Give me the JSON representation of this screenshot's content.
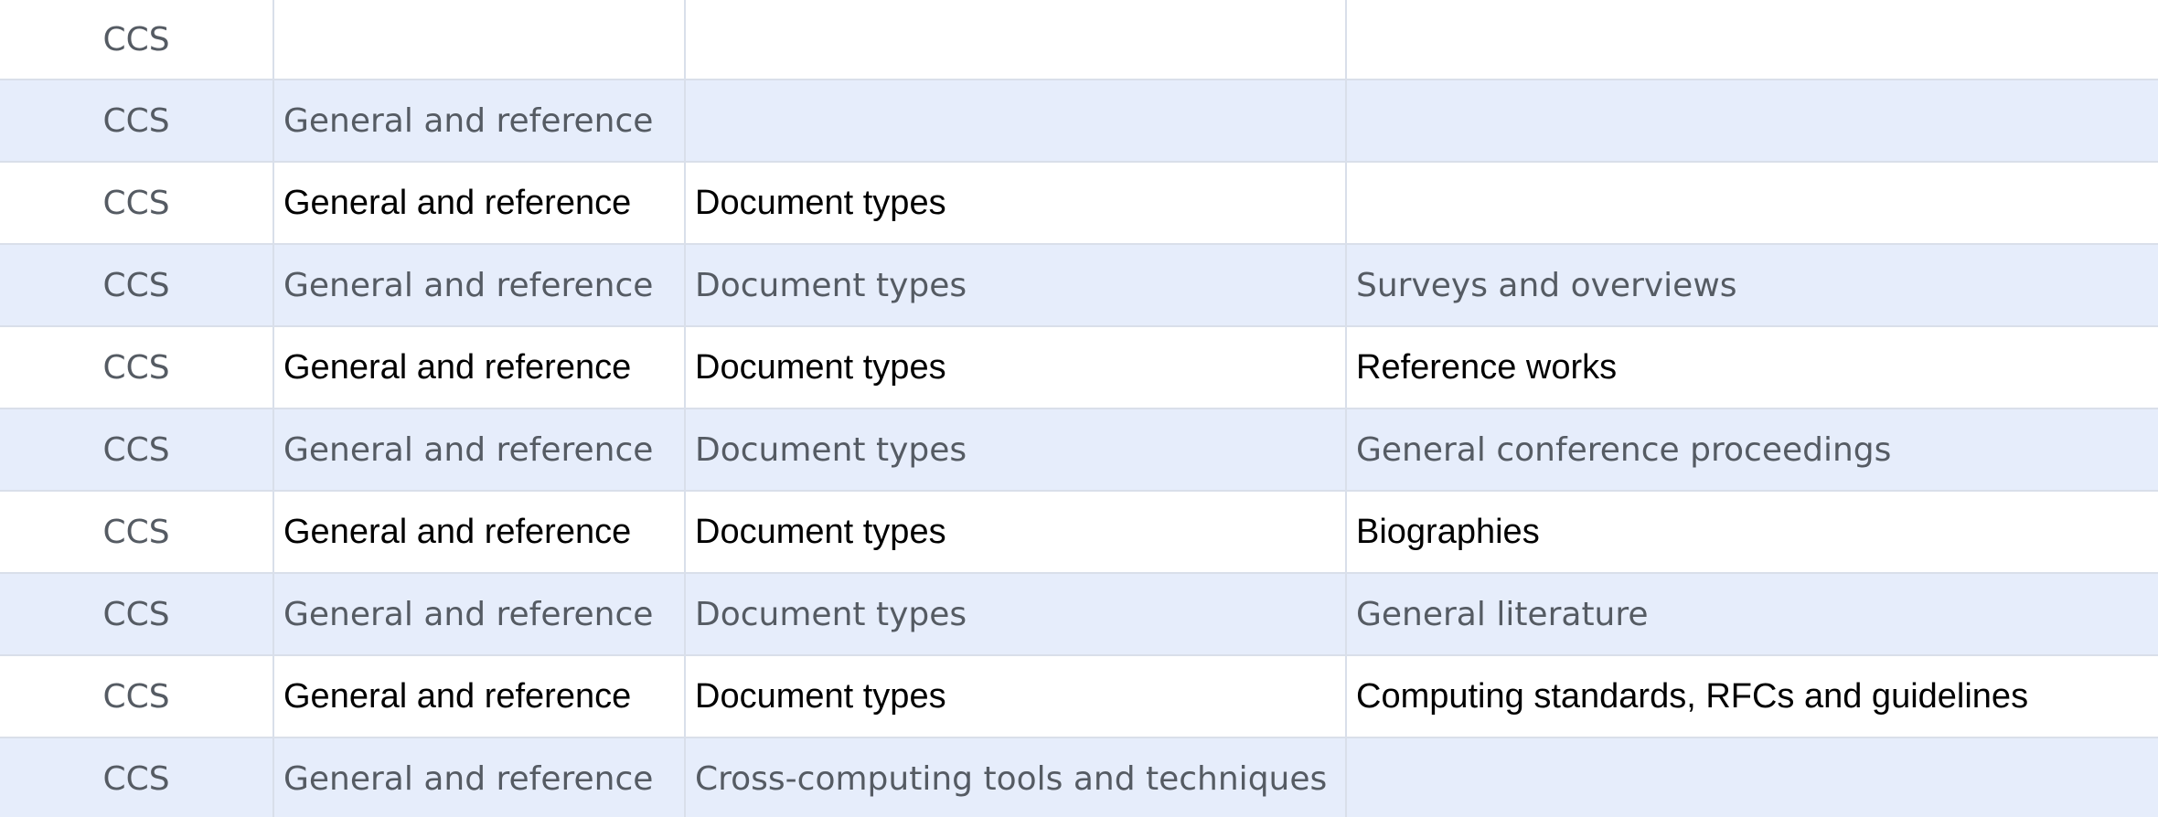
{
  "table": {
    "rows": [
      {
        "style": "plain",
        "cells": [
          "CCS",
          "",
          "",
          ""
        ]
      },
      {
        "style": "alt",
        "cells": [
          "CCS",
          "General and reference",
          "",
          ""
        ]
      },
      {
        "style": "plain",
        "cells": [
          "CCS",
          "General and reference",
          "Document types",
          ""
        ]
      },
      {
        "style": "alt",
        "cells": [
          "CCS",
          "General and reference",
          "Document types",
          "Surveys and overviews"
        ]
      },
      {
        "style": "plain",
        "cells": [
          "CCS",
          "General and reference",
          "Document types",
          "Reference works"
        ]
      },
      {
        "style": "alt",
        "cells": [
          "CCS",
          "General and reference",
          "Document types",
          "General conference proceedings"
        ]
      },
      {
        "style": "plain",
        "cells": [
          "CCS",
          "General and reference",
          "Document types",
          "Biographies"
        ]
      },
      {
        "style": "alt",
        "cells": [
          "CCS",
          "General and reference",
          "Document types",
          "General literature"
        ]
      },
      {
        "style": "plain",
        "cells": [
          "CCS",
          "General and reference",
          "Document types",
          "Computing standards, RFCs and guidelines"
        ]
      },
      {
        "style": "alt",
        "cells": [
          "CCS",
          "General and reference",
          "Cross-computing tools and techniques",
          ""
        ]
      }
    ]
  },
  "colors": {
    "row_alt_bg": "#e6edfb",
    "row_plain_bg": "#ffffff",
    "grid_line": "#d9dfea",
    "alt_text": "#555b63",
    "plain_text": "#000000"
  }
}
